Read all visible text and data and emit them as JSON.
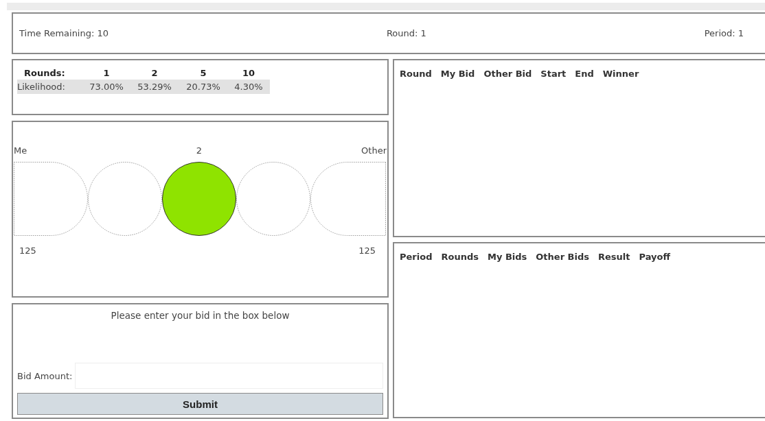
{
  "status": {
    "time_remaining": "Time Remaining: 10",
    "round": "Round: 1",
    "period": "Period: 1"
  },
  "likelihood": {
    "header_label": "Rounds:",
    "row_label": "Likelihood:",
    "columns": [
      {
        "rounds": "1",
        "value": "73.00%"
      },
      {
        "rounds": "2",
        "value": "53.29%"
      },
      {
        "rounds": "5",
        "value": "20.73%"
      },
      {
        "rounds": "10",
        "value": "4.30%"
      }
    ]
  },
  "track": {
    "left_label": "Me",
    "right_label": "Other",
    "position_label": "2",
    "left_amount": "125",
    "right_amount": "125",
    "positions": [
      {
        "selected": false
      },
      {
        "selected": false
      },
      {
        "selected": true
      },
      {
        "selected": false
      },
      {
        "selected": false
      }
    ]
  },
  "bid_form": {
    "instruction": "Please enter your bid in the box below",
    "field_label": "Bid Amount:",
    "submit": "Submit"
  },
  "round_history": {
    "columns": [
      "Round",
      "My Bid",
      "Other Bid",
      "Start",
      "End",
      "Winner"
    ]
  },
  "period_history": {
    "columns": [
      "Period",
      "Rounds",
      "My Bids",
      "Other Bids",
      "Result",
      "Payoff"
    ]
  }
}
